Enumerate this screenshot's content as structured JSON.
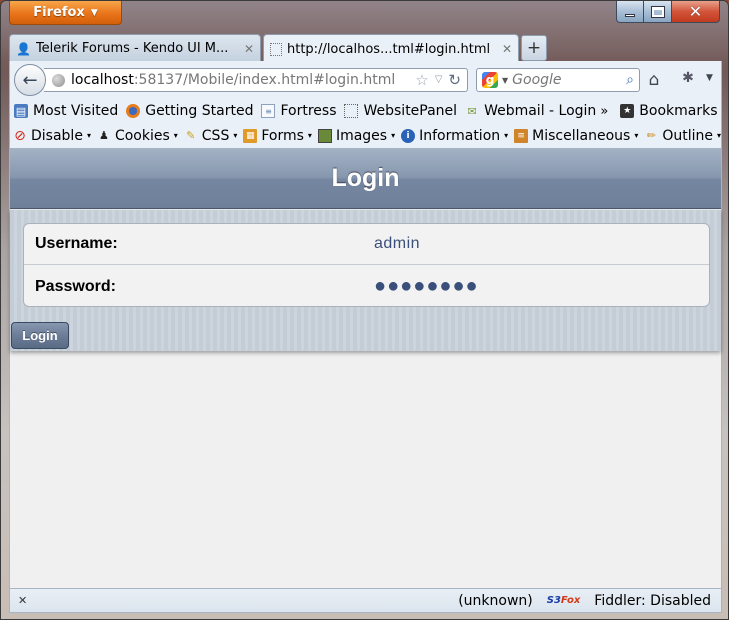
{
  "window": {
    "app_button": "Firefox"
  },
  "tabs": [
    {
      "title": "Telerik Forums - Kendo UI M...",
      "active": false
    },
    {
      "title": "http://localhos...tml#login.html",
      "active": true
    }
  ],
  "navbar": {
    "url_host": "localhost",
    "url_rest": ":58137/Mobile/index.html#login.html",
    "search_placeholder": "Google"
  },
  "bookmarks": [
    {
      "label": "Most Visited",
      "icon": "most-visited-icon"
    },
    {
      "label": "Getting Started",
      "icon": "firefox-icon"
    },
    {
      "label": "Fortress",
      "icon": "page-icon"
    },
    {
      "label": "WebsitePanel",
      "icon": "blank-page-icon"
    },
    {
      "label": "Webmail - Login",
      "icon": "mail-icon"
    }
  ],
  "bookmarks_menu": "Bookmarks",
  "webdev_toolbar": [
    {
      "label": "Disable",
      "icon": "disable-icon"
    },
    {
      "label": "Cookies",
      "icon": "cookie-icon"
    },
    {
      "label": "CSS",
      "icon": "css-icon"
    },
    {
      "label": "Forms",
      "icon": "forms-icon"
    },
    {
      "label": "Images",
      "icon": "images-icon"
    },
    {
      "label": "Information",
      "icon": "info-icon"
    },
    {
      "label": "Miscellaneous",
      "icon": "misc-icon"
    },
    {
      "label": "Outline",
      "icon": "outline-icon"
    }
  ],
  "page": {
    "title": "Login",
    "fields": {
      "username_label": "Username:",
      "username_value": "admin",
      "password_label": "Password:",
      "password_value": "●●●●●●●●"
    },
    "login_button": "Login"
  },
  "statusbar": {
    "status": "(unknown)",
    "s3fox_s3": "S3",
    "s3fox_fox": "Fox",
    "fiddler": "Fiddler: Disabled"
  },
  "colors": {
    "header": "#7486a0",
    "value_text": "#3a4f7a",
    "firefox_button": "#e9741a"
  }
}
